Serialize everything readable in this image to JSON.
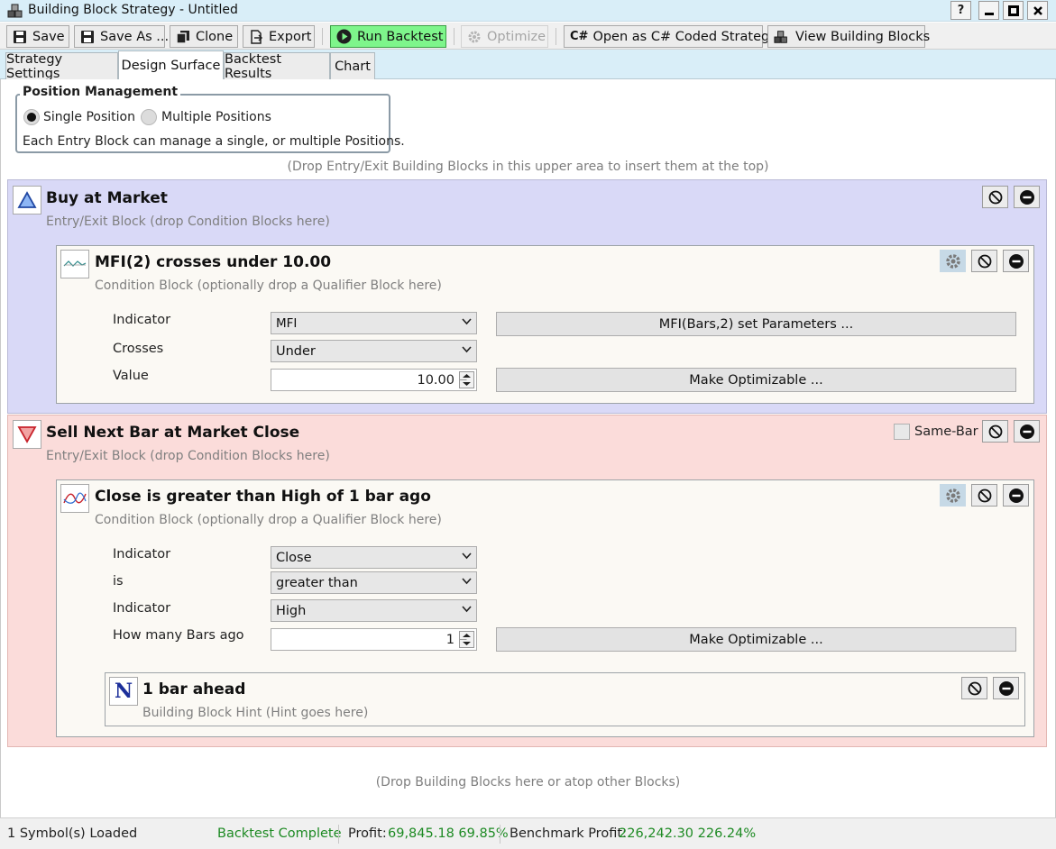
{
  "window": {
    "title": "Building Block Strategy - Untitled",
    "help": "?"
  },
  "toolbar": {
    "save": "Save",
    "save_as": "Save As ...",
    "clone": "Clone",
    "export": "Export",
    "run_backtest": "Run Backtest",
    "optimize": "Optimize",
    "open_csharp": "Open as C# Coded Strategy",
    "view_blocks": "View Building Blocks"
  },
  "tabs": [
    {
      "label": "Strategy Settings",
      "active": false
    },
    {
      "label": "Design Surface",
      "active": true
    },
    {
      "label": "Backtest Results",
      "active": false
    },
    {
      "label": "Chart",
      "active": false
    }
  ],
  "position_management": {
    "title": "Position Management",
    "single": "Single Position",
    "multiple": "Multiple Positions",
    "selected": "single",
    "description": "Each Entry Block can manage a single, or multiple Positions."
  },
  "hints": {
    "top_drop": "(Drop Entry/Exit Building Blocks in this upper area to insert them at the top)",
    "bottom_drop": "(Drop Building Blocks here or atop other Blocks)"
  },
  "entry_block": {
    "title": "Buy at Market",
    "subtitle": "Entry/Exit Block (drop Condition Blocks here)",
    "bg_color": "#d9d9f7",
    "condition": {
      "title": "MFI(2) crosses under 10.00",
      "subtitle": "Condition Block (optionally drop a Qualifier Block here)",
      "rows": [
        {
          "label": "Indicator",
          "value": "MFI"
        },
        {
          "label": "Crosses",
          "value": "Under"
        },
        {
          "label": "Value",
          "value": "10.00"
        }
      ],
      "params_button": "MFI(Bars,2) set Parameters ...",
      "optimizable_button": "Make Optimizable ..."
    }
  },
  "exit_block": {
    "title": "Sell Next Bar at Market Close",
    "subtitle": "Entry/Exit Block (drop Condition Blocks here)",
    "same_bar": "Same-Bar",
    "bg_color": "#fbdcda",
    "condition": {
      "title": "Close is greater than High of 1 bar ago",
      "subtitle": "Condition Block (optionally drop a Qualifier Block here)",
      "rows": [
        {
          "label": "Indicator",
          "value": "Close"
        },
        {
          "label": "is",
          "value": "greater than"
        },
        {
          "label": "Indicator",
          "value": "High"
        },
        {
          "label": "How many Bars ago",
          "value": "1"
        }
      ],
      "optimizable_button": "Make Optimizable ..."
    },
    "hint_block": {
      "icon_letter": "N",
      "title": "1 bar ahead",
      "subtitle": "Building Block Hint (Hint goes here)"
    }
  },
  "status": {
    "symbols": "1 Symbol(s) Loaded",
    "backtest": "Backtest Complete",
    "profit_label": "Profit:",
    "profit_value": "69,845.18 69.85%",
    "benchmark_label": "Benchmark Profit:",
    "benchmark_value": "226,242.30 226.24%"
  },
  "colors": {
    "accent_green": "#1d8a23",
    "run_button": "#7ef58b",
    "title_bar": "#d9eef8"
  }
}
